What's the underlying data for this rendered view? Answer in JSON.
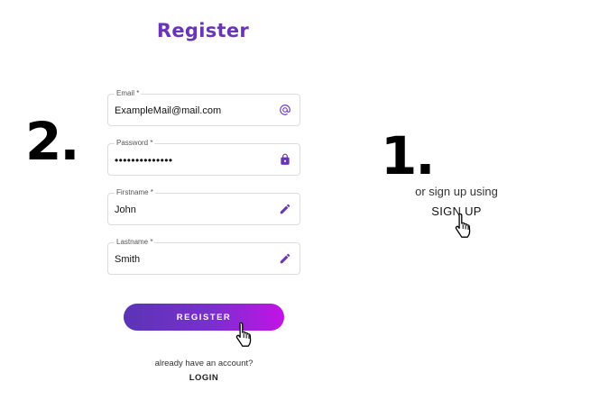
{
  "header": {
    "title": "Register"
  },
  "steps": {
    "left": "2.",
    "right": "1."
  },
  "form": {
    "email": {
      "label": "Email *",
      "value": "ExampleMail@mail.com"
    },
    "password": {
      "label": "Password *",
      "value": "••••••••••••••"
    },
    "firstname": {
      "label": "Firstname *",
      "value": "John"
    },
    "lastname": {
      "label": "Lastname *",
      "value": "Smith"
    },
    "register_label": "REGISTER",
    "already_text": "already have an account?",
    "login_label": "LOGIN"
  },
  "alternate": {
    "text": "or sign up using",
    "signup_label": "SIGN UP"
  },
  "colors": {
    "accent": "#6a34b8",
    "gradient_start": "#5b34b5",
    "gradient_end": "#c313e6"
  },
  "icons": {
    "email": "at-icon",
    "password": "lock-icon",
    "firstname": "pencil-icon",
    "lastname": "pencil-icon",
    "cursor": "hand-pointer-cursor-icon"
  }
}
